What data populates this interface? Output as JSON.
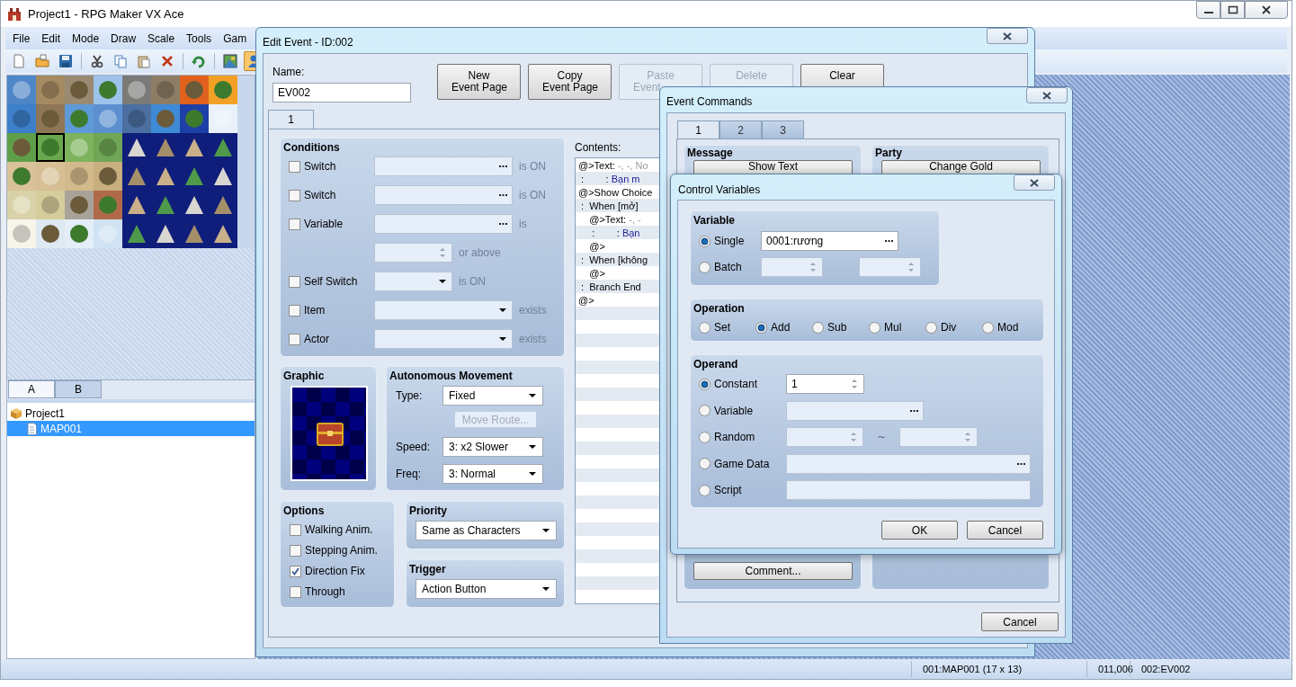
{
  "window": {
    "title": "Project1 - RPG Maker VX Ace"
  },
  "menu": [
    "File",
    "Edit",
    "Mode",
    "Draw",
    "Scale",
    "Tools",
    "Gam"
  ],
  "toolbar": [
    {
      "selected": false
    },
    {
      "selected": false
    },
    {
      "selected": false
    },
    {
      "selected": false
    },
    {
      "selected": false
    },
    {
      "selected": false
    },
    {
      "selected": false
    },
    {
      "selected": false
    },
    {
      "selected": false
    },
    {
      "selected": true
    }
  ],
  "tileset_tabs": [
    {
      "label": "A",
      "selected": true
    },
    {
      "label": "B",
      "selected": false
    }
  ],
  "map_tree": [
    {
      "label": "Project1",
      "selected": false,
      "children": [
        {
          "label": "MAP001",
          "selected": true
        }
      ]
    }
  ],
  "status_bar": [
    "001:MAP001 (17 x 13)",
    "011,006",
    "002:EV002"
  ],
  "edit_event": {
    "title": "Edit Event - ID:002",
    "name_label": "Name:",
    "name": "EV002",
    "page_buttons": [
      {
        "lines": [
          "New",
          "Event Page"
        ],
        "disabled": false
      },
      {
        "lines": [
          "Copy",
          "Event Page"
        ],
        "disabled": false
      },
      {
        "lines": [
          "Paste",
          "Event"
        ],
        "disabled": true
      },
      {
        "lines": [
          "Delete"
        ],
        "disabled": true
      },
      {
        "lines": [
          "Clear"
        ],
        "disabled": false
      }
    ],
    "pages": [
      {
        "label": "1",
        "selected": true
      }
    ],
    "conditions": {
      "title": "Conditions",
      "rows": [
        {
          "kind": "check",
          "label": "Switch",
          "checked": false,
          "field": {
            "kind": "picker"
          },
          "suffix": "is ON"
        },
        {
          "kind": "check",
          "label": "Switch",
          "checked": false,
          "field": {
            "kind": "picker"
          },
          "suffix": "is ON"
        },
        {
          "kind": "check",
          "label": "Variable",
          "checked": false,
          "field": {
            "kind": "picker"
          },
          "suffix": "is"
        },
        {
          "kind": "value",
          "field": {
            "kind": "spinner"
          },
          "suffix": "or above"
        },
        {
          "kind": "check",
          "label": "Self Switch",
          "checked": false,
          "field": {
            "kind": "dropdown_short"
          },
          "suffix": "is ON"
        },
        {
          "kind": "check",
          "label": "Item",
          "checked": false,
          "field": {
            "kind": "dropdown"
          },
          "suffix": "exists"
        },
        {
          "kind": "check",
          "label": "Actor",
          "checked": false,
          "field": {
            "kind": "dropdown"
          },
          "suffix": "exists"
        }
      ]
    },
    "graphic": {
      "title": "Graphic"
    },
    "movement": {
      "title": "Autonomous Movement",
      "type_label": "Type:",
      "type": "Fixed",
      "route_button": {
        "label": "Move Route...",
        "disabled": true
      },
      "speed_label": "Speed:",
      "speed": "3: x2 Slower",
      "freq_label": "Freq:",
      "freq": "3: Normal"
    },
    "options": {
      "title": "Options",
      "items": [
        {
          "label": "Walking Anim.",
          "checked": false
        },
        {
          "label": "Stepping Anim.",
          "checked": false
        },
        {
          "label": "Direction Fix",
          "checked": true
        },
        {
          "label": "Through",
          "checked": false
        }
      ]
    },
    "priority": {
      "title": "Priority",
      "value": "Same as Characters"
    },
    "trigger": {
      "title": "Trigger",
      "value": "Action Button"
    },
    "contents": {
      "label": "Contents:",
      "lines": [
        {
          "segments": [
            {
              "kind": "plain",
              "text": "@>Text: "
            },
            {
              "kind": "param",
              "text": "-, -, No"
            }
          ]
        },
        {
          "segments": [
            {
              "kind": "plain",
              "text": " :        : "
            },
            {
              "kind": "message",
              "text": "Bạn m"
            }
          ]
        },
        {
          "segments": [
            {
              "kind": "plain",
              "text": "@>Show Choice"
            }
          ]
        },
        {
          "segments": [
            {
              "kind": "plain",
              "text": " :  When [mở]"
            }
          ]
        },
        {
          "segments": [
            {
              "kind": "plain",
              "text": "    @>Text: "
            },
            {
              "kind": "param",
              "text": "-, -"
            }
          ]
        },
        {
          "segments": [
            {
              "kind": "plain",
              "text": "     :        : "
            },
            {
              "kind": "message",
              "text": "Bạn"
            }
          ]
        },
        {
          "segments": [
            {
              "kind": "plain",
              "text": "    @>"
            }
          ]
        },
        {
          "segments": [
            {
              "kind": "plain",
              "text": " :  When [không"
            }
          ]
        },
        {
          "segments": [
            {
              "kind": "plain",
              "text": "    @>"
            }
          ]
        },
        {
          "segments": [
            {
              "kind": "plain",
              "text": " :  Branch End"
            }
          ]
        },
        {
          "segments": [
            {
              "kind": "plain",
              "text": "@>"
            }
          ]
        }
      ]
    }
  },
  "event_commands": {
    "title": "Event Commands",
    "tabs": [
      {
        "label": "1",
        "selected": true
      },
      {
        "label": "2",
        "selected": false
      },
      {
        "label": "3",
        "selected": false
      }
    ],
    "groups": [
      {
        "title": "Message",
        "top_button": "Show Text",
        "bottom_button": "Comment..."
      },
      {
        "title": "Party",
        "top_button": "Change Gold"
      }
    ],
    "cancel": "Cancel"
  },
  "control_variables": {
    "title": "Control Variables",
    "variable": {
      "title": "Variable",
      "options": [
        {
          "label": "Single",
          "selected": true,
          "kind": "picker",
          "value": "0001:rương"
        },
        {
          "label": "Batch",
          "selected": false,
          "kind": "range"
        }
      ]
    },
    "operation": {
      "title": "Operation",
      "options": [
        {
          "label": "Set",
          "selected": false
        },
        {
          "label": "Add",
          "selected": true
        },
        {
          "label": "Sub",
          "selected": false
        },
        {
          "label": "Mul",
          "selected": false
        },
        {
          "label": "Div",
          "selected": false
        },
        {
          "label": "Mod",
          "selected": false
        }
      ]
    },
    "operand": {
      "title": "Operand",
      "options": [
        {
          "label": "Constant",
          "selected": true,
          "kind": "spinner",
          "value": "1"
        },
        {
          "label": "Variable",
          "selected": false,
          "kind": "picker"
        },
        {
          "label": "Random",
          "selected": false,
          "kind": "range",
          "separator": "~"
        },
        {
          "label": "Game Data",
          "selected": false,
          "kind": "picker_wide"
        },
        {
          "label": "Script",
          "selected": false,
          "kind": "text"
        }
      ]
    },
    "buttons": [
      "OK",
      "Cancel"
    ]
  }
}
